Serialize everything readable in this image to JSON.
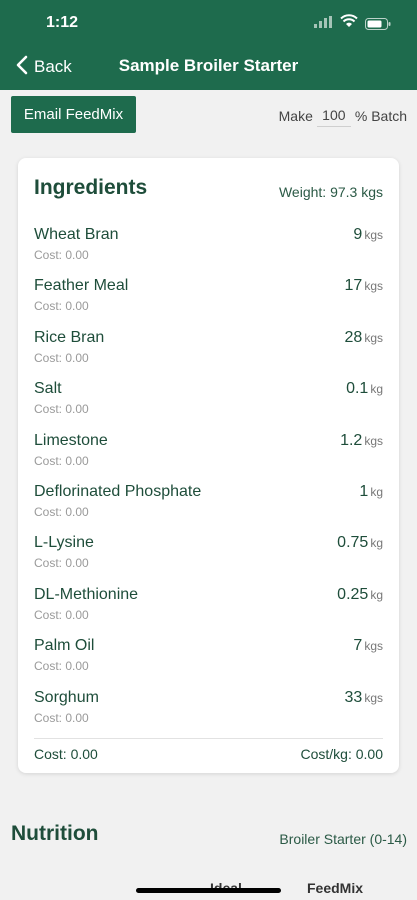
{
  "status_bar": {
    "time": "1:12"
  },
  "nav": {
    "back_label": "Back",
    "title": "Sample Broiler Starter"
  },
  "toolbar": {
    "email_label": "Email FeedMix",
    "make_label": "Make",
    "batch_value": "100",
    "batch_suffix": "% Batch"
  },
  "ingredients": {
    "title": "Ingredients",
    "weight_label": "Weight: 97.3 kgs",
    "items": [
      {
        "name": "Wheat Bran",
        "cost": "Cost: 0.00",
        "qty": "9",
        "unit": "kgs"
      },
      {
        "name": "Feather Meal",
        "cost": "Cost: 0.00",
        "qty": "17",
        "unit": "kgs"
      },
      {
        "name": "Rice Bran",
        "cost": "Cost: 0.00",
        "qty": "28",
        "unit": "kgs"
      },
      {
        "name": "Salt",
        "cost": "Cost: 0.00",
        "qty": "0.1",
        "unit": "kg"
      },
      {
        "name": "Limestone",
        "cost": "Cost: 0.00",
        "qty": "1.2",
        "unit": "kgs"
      },
      {
        "name": "Deflorinated Phosphate",
        "cost": "Cost: 0.00",
        "qty": "1",
        "unit": "kg"
      },
      {
        "name": "L-Lysine",
        "cost": "Cost: 0.00",
        "qty": "0.75",
        "unit": "kg"
      },
      {
        "name": "DL-Methionine",
        "cost": "Cost: 0.00",
        "qty": "0.25",
        "unit": "kg"
      },
      {
        "name": "Palm Oil",
        "cost": "Cost: 0.00",
        "qty": "7",
        "unit": "kgs"
      },
      {
        "name": "Sorghum",
        "cost": "Cost: 0.00",
        "qty": "33",
        "unit": "kgs"
      }
    ],
    "footer_cost": "Cost: 0.00",
    "footer_cost_per_kg": "Cost/kg: 0.00"
  },
  "nutrition": {
    "title": "Nutrition",
    "profile": "Broiler Starter (0-14)"
  },
  "tabs": {
    "ideal": "Ideal",
    "feedmix": "FeedMix"
  },
  "colors": {
    "brand": "#1e6b4d",
    "text_dark_green": "#1e4d3a",
    "muted": "#9a9a9a"
  }
}
